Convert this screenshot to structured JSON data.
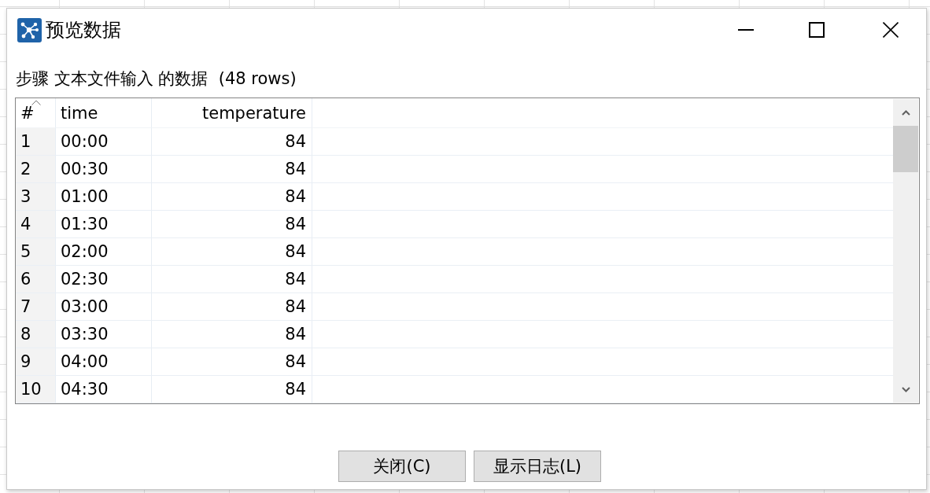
{
  "window": {
    "title": "预览数据"
  },
  "heading": "步骤 文本文件输入 的数据  (48 rows)",
  "table": {
    "columns": [
      {
        "label": "#",
        "kind": "index",
        "sorted": true
      },
      {
        "label": "time",
        "kind": "text",
        "sorted": false
      },
      {
        "label": "temperature",
        "kind": "number",
        "sorted": false
      }
    ],
    "rows": [
      [
        "1",
        "00:00",
        "84"
      ],
      [
        "2",
        "00:30",
        "84"
      ],
      [
        "3",
        "01:00",
        "84"
      ],
      [
        "4",
        "01:30",
        "84"
      ],
      [
        "5",
        "02:00",
        "84"
      ],
      [
        "6",
        "02:30",
        "84"
      ],
      [
        "7",
        "03:00",
        "84"
      ],
      [
        "8",
        "03:30",
        "84"
      ],
      [
        "9",
        "04:00",
        "84"
      ],
      [
        "10",
        "04:30",
        "84"
      ]
    ]
  },
  "buttons": [
    {
      "label": "关闭(C)"
    },
    {
      "label": "显示日志(L)"
    }
  ]
}
